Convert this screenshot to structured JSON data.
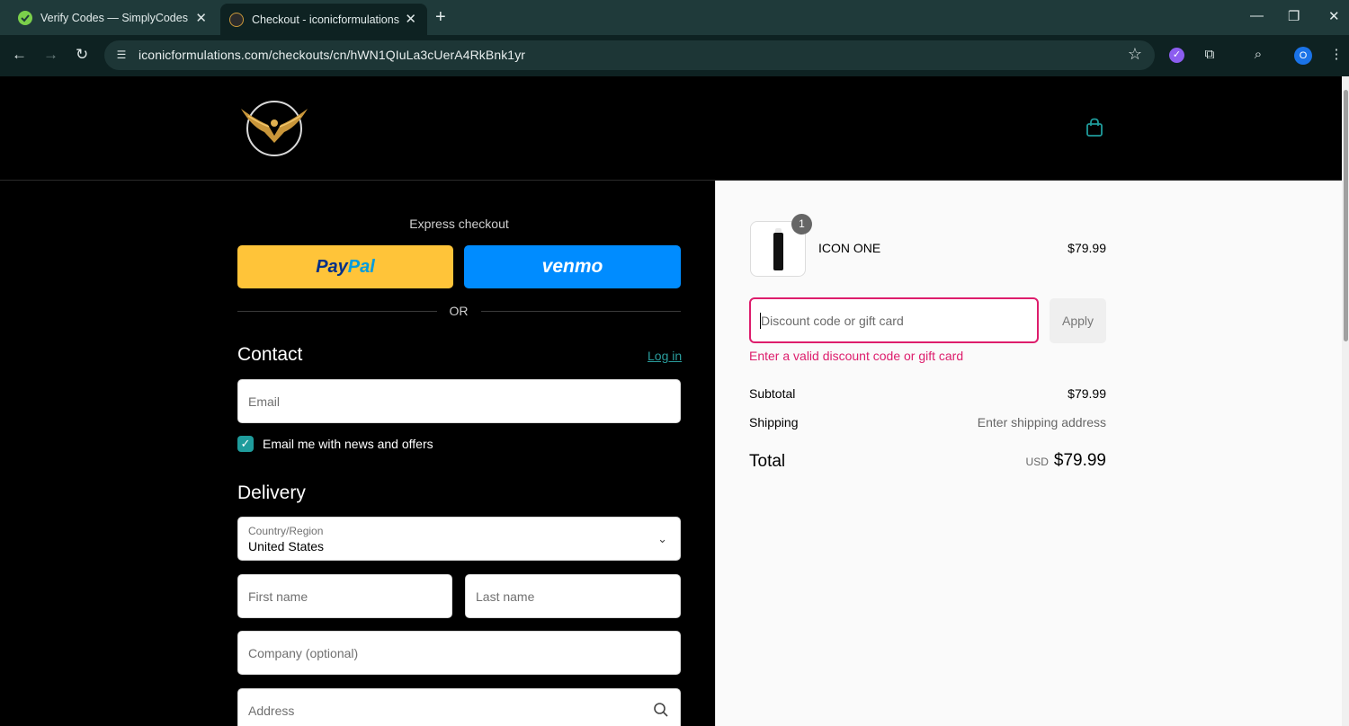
{
  "browser": {
    "tabs": [
      {
        "title": "Verify Codes — SimplyCodes",
        "active": false
      },
      {
        "title": "Checkout - iconicformulations",
        "active": true
      }
    ],
    "url": "iconicformulations.com/checkouts/cn/hWN1QIuLa3cUerA4RkBnk1yr",
    "profile_initial": "O"
  },
  "checkout": {
    "express": {
      "title": "Express checkout",
      "paypal_pay": "Pay",
      "paypal_pal": "Pal",
      "venmo": "venmo",
      "or": "OR"
    },
    "contact": {
      "heading": "Contact",
      "login": "Log in",
      "email_placeholder": "Email",
      "newsletter_label": "Email me with news and offers",
      "newsletter_checked": true
    },
    "delivery": {
      "heading": "Delivery",
      "country_label": "Country/Region",
      "country_value": "United States",
      "first_name_placeholder": "First name",
      "last_name_placeholder": "Last name",
      "company_placeholder": "Company (optional)",
      "address_placeholder": "Address"
    }
  },
  "summary": {
    "item": {
      "name": "ICON ONE",
      "price": "$79.99",
      "quantity": "1"
    },
    "discount_placeholder": "Discount code or gift card",
    "apply_label": "Apply",
    "discount_error": "Enter a valid discount code or gift card",
    "subtotal_label": "Subtotal",
    "subtotal_value": "$79.99",
    "shipping_label": "Shipping",
    "shipping_value": "Enter shipping address",
    "total_label": "Total",
    "total_currency": "USD",
    "total_value": "$79.99"
  },
  "colors": {
    "accent": "#1f9c9c",
    "error": "#dd1d6c",
    "paypal_yellow": "#ffc439",
    "venmo_blue": "#008cff"
  },
  "icons": [
    "back-icon",
    "forward-icon",
    "reload-icon",
    "site-info-icon",
    "star-icon",
    "extensions-icon",
    "bag-icon",
    "chevron-down-icon",
    "search-icon",
    "check-icon"
  ]
}
